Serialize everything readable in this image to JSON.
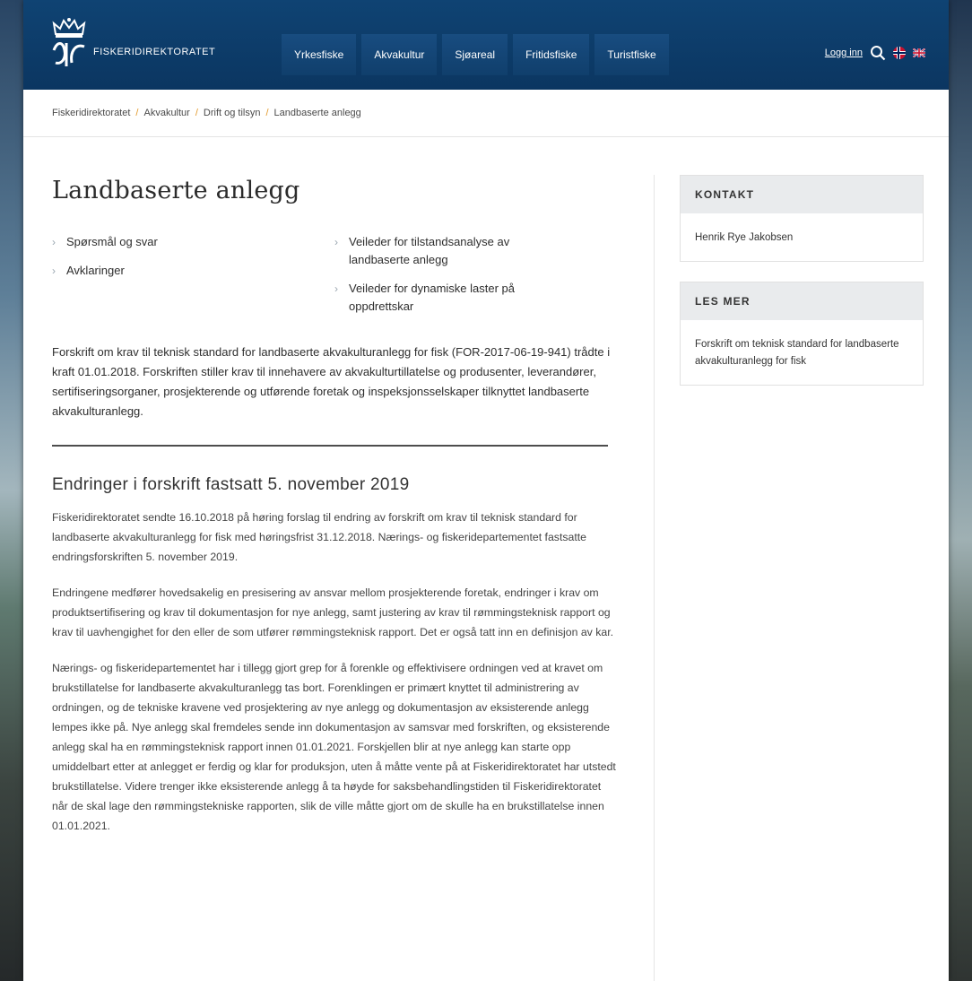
{
  "header": {
    "logo_text": "FISKERIDIREKTORATET",
    "nav": [
      "Yrkesfiske",
      "Akvakultur",
      "Sjøareal",
      "Fritidsfiske",
      "Turistfiske"
    ],
    "login": "Logg inn",
    "icons": [
      "search-icon",
      "flag-norway-icon",
      "flag-uk-icon"
    ],
    "colors": {
      "header_bg": "#0e3d6b",
      "nav_bg": "#13477a",
      "breadcrumb_sep": "#e39a2d"
    }
  },
  "breadcrumb": [
    "Fiskeridirektoratet",
    "Akvakultur",
    "Drift og tilsyn",
    "Landbaserte anlegg"
  ],
  "main": {
    "title": "Landbaserte anlegg",
    "links_left": [
      "Spørsmål og svar",
      "Avklaringer"
    ],
    "links_right": [
      "Veileder for tilstandsanalyse av landbaserte anlegg",
      "Veileder for dynamiske laster på oppdrettskar"
    ],
    "intro": "Forskrift om krav til teknisk standard for landbaserte akvakulturanlegg for fisk (FOR-2017-06-19-941) trådte i kraft 01.01.2018. Forskriften stiller krav til innehavere av akvakulturtillatelse og produsenter, leverandører, sertifiseringsorganer, prosjekterende og utførende foretak og inspeksjonsselskaper tilknyttet landbaserte akvakulturanlegg.",
    "section_heading": "Endringer i forskrift fastsatt 5. november 2019",
    "paragraphs": [
      "Fiskeridirektoratet sendte 16.10.2018 på høring forslag til endring av forskrift om krav til teknisk standard for landbaserte akvakulturanlegg for fisk med høringsfrist 31.12.2018. Nærings- og fiskeridepartementet fastsatte endringsforskriften 5. november 2019.",
      "Endringene medfører hovedsakelig en presisering av ansvar mellom prosjekterende foretak, endringer i krav om produktsertifisering og krav til dokumentasjon for nye anlegg, samt justering av krav til rømmingsteknisk rapport og krav til uavhengighet for den eller de som utfører rømmingsteknisk rapport. Det er også tatt inn en definisjon av kar.",
      "Nærings- og fiskeridepartementet har i tillegg gjort grep for å forenkle og effektivisere ordningen ved at kravet om brukstillatelse for landbaserte akvakulturanlegg tas bort. Forenklingen er primært knyttet til administrering av ordningen, og de tekniske kravene ved prosjektering av nye anlegg og dokumentasjon av eksisterende anlegg lempes ikke på. Nye anlegg skal fremdeles sende inn dokumentasjon av samsvar med forskriften, og eksisterende anlegg skal ha en rømmingsteknisk rapport innen 01.01.2021. Forskjellen blir at nye anlegg kan starte opp umiddelbart etter at anlegget er ferdig og klar for produksjon, uten å måtte vente på at Fiskeridirektoratet har utstedt brukstillatelse. Videre trenger ikke eksisterende anlegg å ta høyde for saksbehandlingstiden til Fiskeridirektoratet når de skal lage den rømmingstekniske rapporten, slik de ville måtte gjort om de skulle ha en brukstillatelse innen 01.01.2021."
    ]
  },
  "sidebar": {
    "contact_title": "KONTAKT",
    "contact_name": "Henrik Rye Jakobsen",
    "read_more_title": "LES MER",
    "read_more_link": "Forskrift om teknisk standard for landbaserte akvakulturanlegg for fisk"
  }
}
